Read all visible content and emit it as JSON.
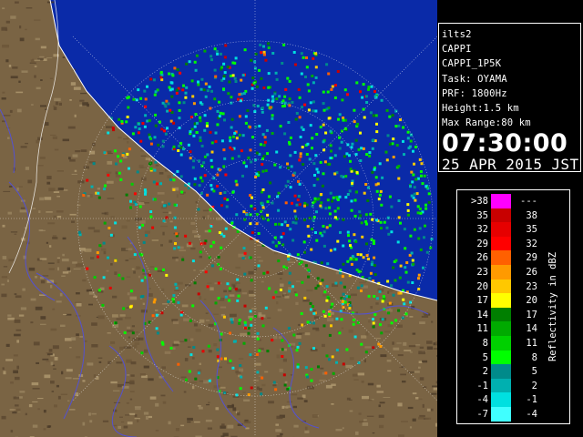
{
  "info": {
    "line1": "ilts2",
    "line2": "CAPPI",
    "line3": "CAPPI_1P5K",
    "line4": "Task: OYAMA",
    "line5": "PRF: 1800Hz",
    "line6": "Height:1.5 km",
    "line7": "Max Range:80 km",
    "time": "07:30:00",
    "date": "25 APR 2015 JST"
  },
  "legend": {
    "title": "Reflectivity in dBZ",
    "rows": [
      {
        "low": ">38",
        "high": "---",
        "color": "#ff00ff"
      },
      {
        "low": "35",
        "high": "38",
        "color": "#c80000"
      },
      {
        "low": "32",
        "high": "35",
        "color": "#e60000"
      },
      {
        "low": "29",
        "high": "32",
        "color": "#ff0000"
      },
      {
        "low": "26",
        "high": "29",
        "color": "#ff6000"
      },
      {
        "low": "23",
        "high": "26",
        "color": "#ff9a00"
      },
      {
        "low": "20",
        "high": "23",
        "color": "#ffc800"
      },
      {
        "low": "17",
        "high": "20",
        "color": "#ffff00"
      },
      {
        "low": "14",
        "high": "17",
        "color": "#007f00"
      },
      {
        "low": "11",
        "high": "14",
        "color": "#00aa00"
      },
      {
        "low": "8",
        "high": "11",
        "color": "#00d000"
      },
      {
        "low": "5",
        "high": "8",
        "color": "#00ff00"
      },
      {
        "low": "2",
        "high": "5",
        "color": "#008a8a"
      },
      {
        "low": "-1",
        "high": "2",
        "color": "#00b0b0"
      },
      {
        "low": "-4",
        "high": "-1",
        "color": "#00e0e0"
      },
      {
        "low": "-7",
        "high": "-4",
        "color": "#40ffff"
      }
    ]
  },
  "colors": {
    "background": "#000000",
    "sea": "#0a2aa8",
    "no_echo_land": "#8a7450",
    "radar_disk": "#c8b48c",
    "rivers": "#5050e0",
    "boundaries": "#ffffff"
  }
}
